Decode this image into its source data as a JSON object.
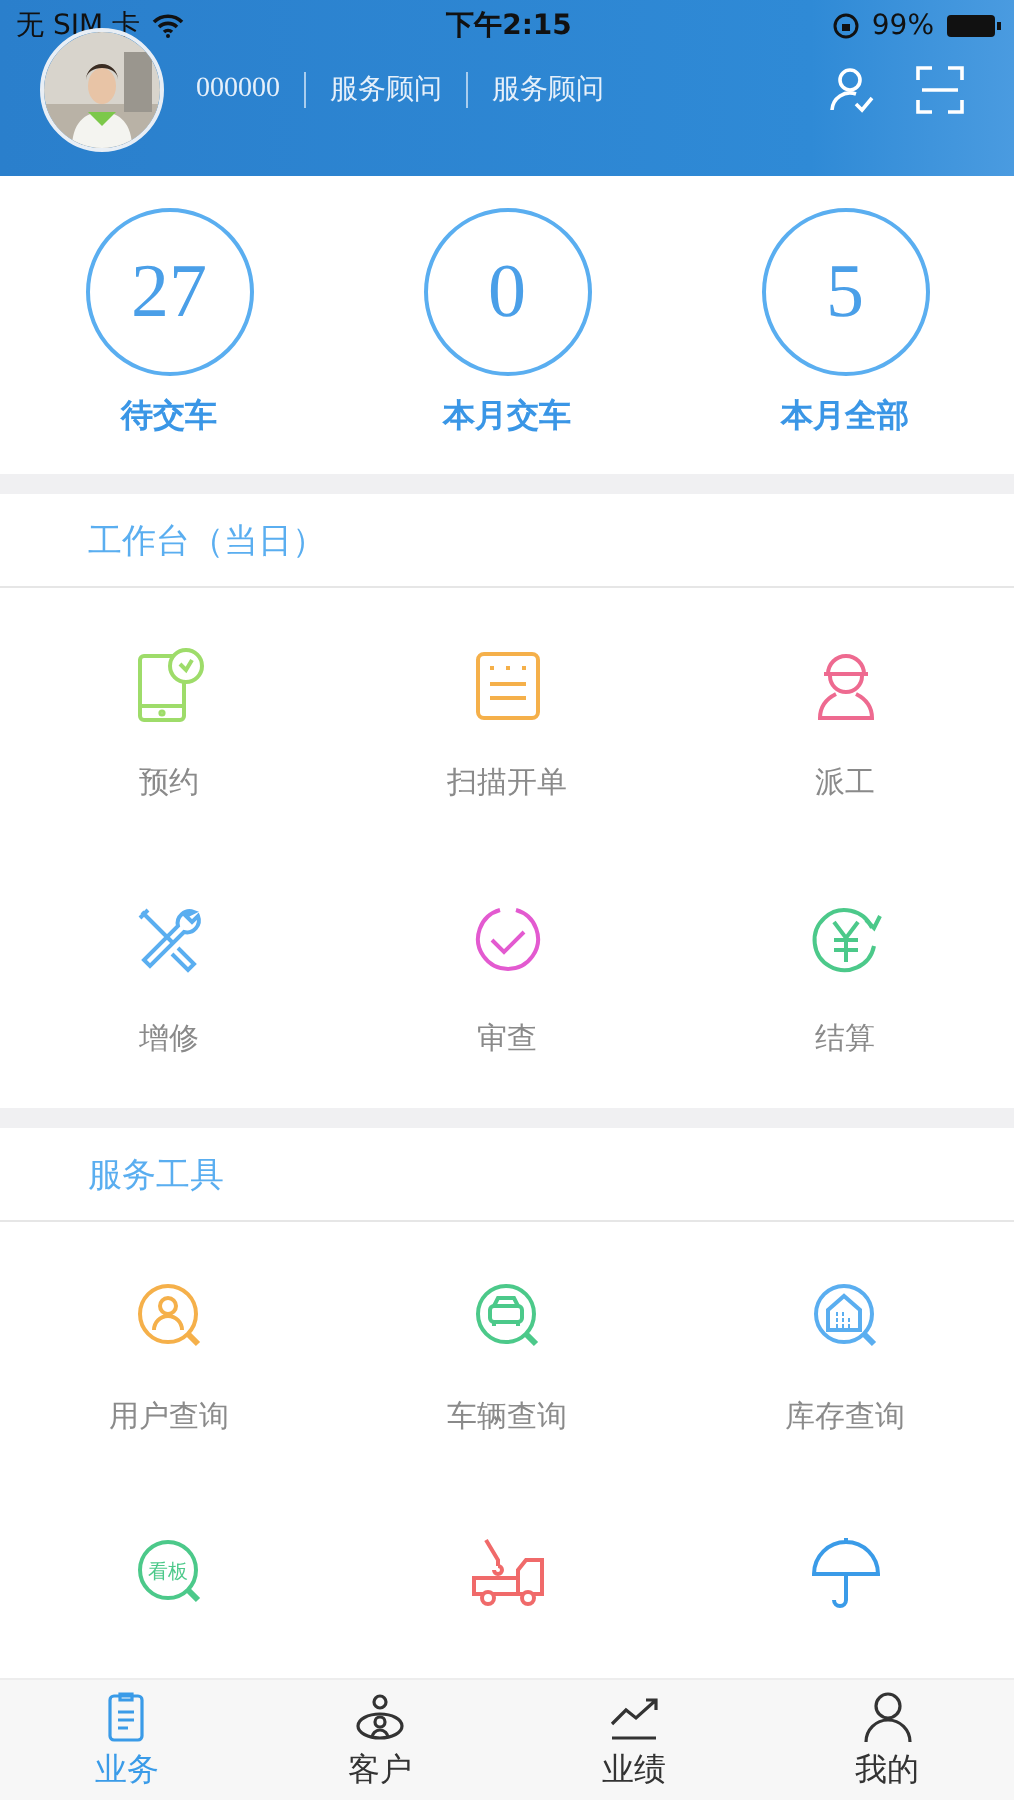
{
  "status_bar": {
    "carrier": "无 SIM 卡",
    "time": "下午2:15",
    "battery": "99%"
  },
  "header": {
    "employee_id": "000000",
    "role": "服务顾问",
    "position": "服务顾问"
  },
  "stats": [
    {
      "value": "27",
      "label": "待交车"
    },
    {
      "value": "0",
      "label": "本月交车"
    },
    {
      "value": "5",
      "label": "本月全部"
    }
  ],
  "sections": [
    {
      "title": "工作台（当日）",
      "items": [
        {
          "kind": "phone-clock",
          "label": "预约",
          "color": "#9edc6a"
        },
        {
          "kind": "form",
          "label": "扫描开单",
          "color": "#f5b04a"
        },
        {
          "kind": "worker",
          "label": "派工",
          "color": "#ee6a90"
        },
        {
          "kind": "tools",
          "label": "增修",
          "color": "#5aaef0"
        },
        {
          "kind": "check",
          "label": "审查",
          "color": "#e35ad0"
        },
        {
          "kind": "yuan",
          "label": "结算",
          "color": "#4cc98a"
        }
      ]
    },
    {
      "title": "服务工具",
      "items": [
        {
          "kind": "user-search",
          "label": "用户查询",
          "color": "#f5b04a"
        },
        {
          "kind": "car-search",
          "label": "车辆查询",
          "color": "#4cc98a"
        },
        {
          "kind": "house-search",
          "label": "库存查询",
          "color": "#5aaef0"
        },
        {
          "kind": "board-search",
          "icon_text": "看板",
          "color": "#4cc98a"
        },
        {
          "kind": "tow-truck",
          "color": "#f06a6a"
        },
        {
          "kind": "umbrella",
          "color": "#3a9be8"
        }
      ]
    }
  ],
  "tab_bar": [
    {
      "kind": "clipboard",
      "label": "业务",
      "selected": true
    },
    {
      "kind": "customers",
      "label": "客户",
      "selected": false
    },
    {
      "kind": "trend",
      "label": "业绩",
      "selected": false
    },
    {
      "kind": "person",
      "label": "我的",
      "selected": false
    }
  ]
}
